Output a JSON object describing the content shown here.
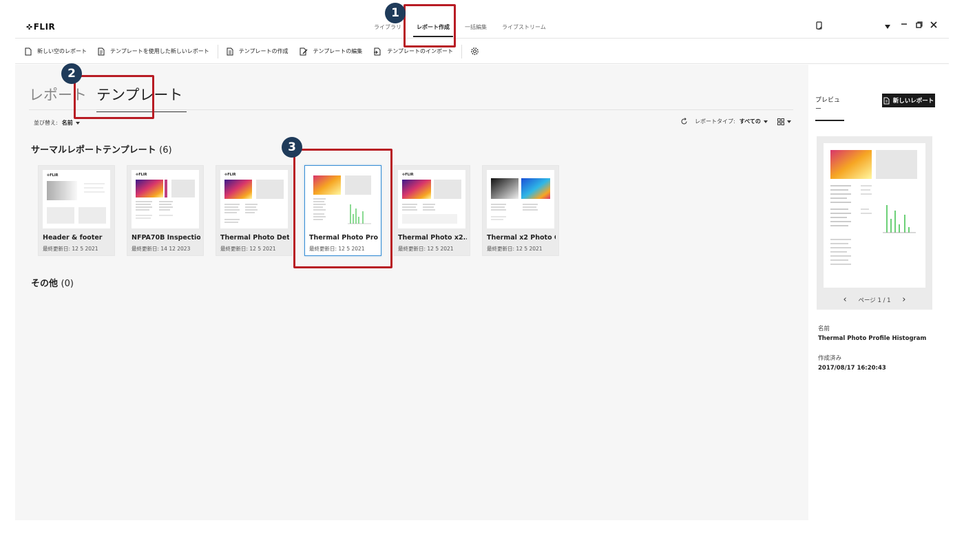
{
  "app": {
    "logo_text": "FLIR"
  },
  "nav": {
    "tabs": [
      {
        "label": "ライブラリ",
        "active": false
      },
      {
        "label": "レポート作成",
        "active": true
      },
      {
        "label": "一括編集",
        "active": false
      },
      {
        "label": "ライブストリーム",
        "active": false
      }
    ]
  },
  "toolbar": {
    "new_blank_report": "新しい空のレポート",
    "new_report_from_template": "テンプレートを使用した新しいレポート",
    "create_template": "テンプレートの作成",
    "edit_template": "テンプレートの編集",
    "import_template": "テンプレートのインポート"
  },
  "page_tabs": {
    "report": "レポート",
    "template": "テンプレート"
  },
  "sort": {
    "label": "並び替え:",
    "value": "名前"
  },
  "filter": {
    "label": "レポートタイプ:",
    "value": "すべての"
  },
  "sections": {
    "thermal": {
      "title": "サーマルレポートテンプレート",
      "count": "(6)"
    },
    "other": {
      "title": "その他",
      "count": "(0)"
    }
  },
  "templates": [
    {
      "title": "Header & footer",
      "date": "最終更新日: 12 5 2021",
      "selected": false
    },
    {
      "title": "NFPA70B Inspectio...",
      "date": "最終更新日: 14 12 2023",
      "selected": false
    },
    {
      "title": "Thermal Photo Det...",
      "date": "最終更新日: 12 5 2021",
      "selected": false
    },
    {
      "title": "Thermal Photo Pro...",
      "date": "最終更新日: 12 5 2021",
      "selected": true
    },
    {
      "title": "Thermal Photo x2...",
      "date": "最終更新日: 12 5 2021",
      "selected": false
    },
    {
      "title": "Thermal x2 Photo C...",
      "date": "最終更新日: 12 5 2021",
      "selected": false
    }
  ],
  "preview": {
    "tab_label": "プレビュー",
    "new_report_label": "新しいレポート",
    "pager": "ページ 1 / 1",
    "name_label": "名前",
    "name_value": "Thermal Photo Profile Histogram",
    "created_label": "作成済み",
    "created_value": "2017/08/17 16:20:43"
  },
  "annotations": [
    {
      "number": "1"
    },
    {
      "number": "2"
    },
    {
      "number": "3"
    }
  ],
  "colors": {
    "annotation_red": "#b81c24",
    "annotation_badge": "#1f3b5a",
    "selection_blue": "#3a8fd6"
  }
}
